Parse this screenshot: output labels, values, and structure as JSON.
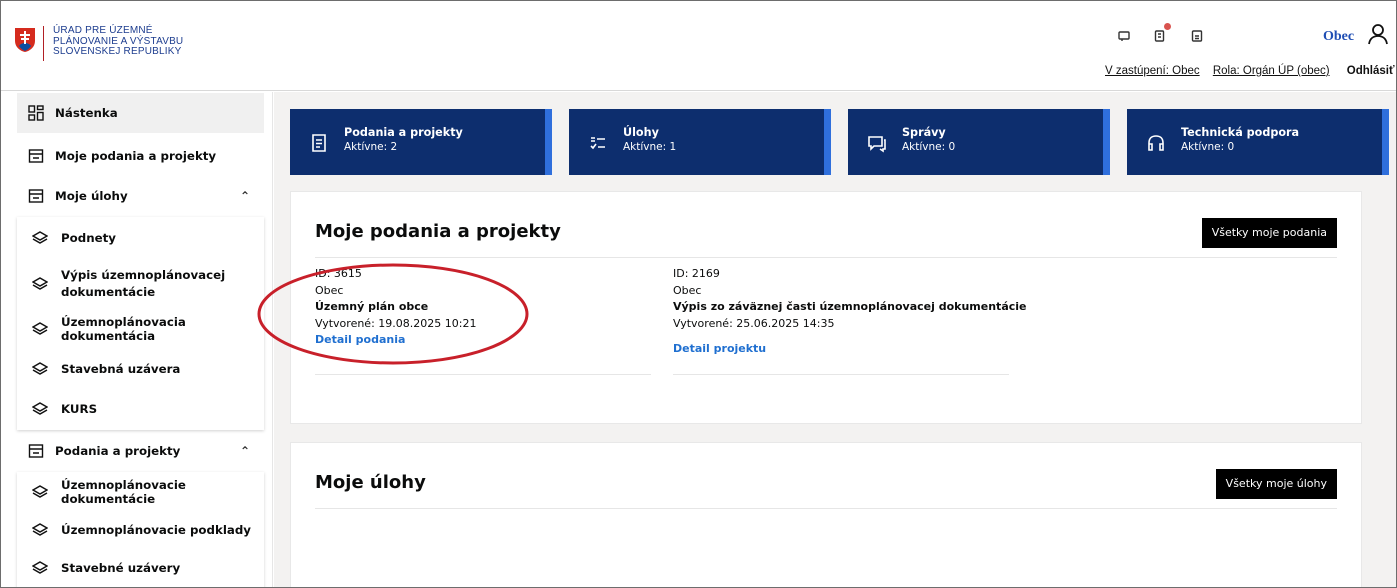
{
  "header": {
    "logo_lines": [
      "ÚRAD PRE ÚZEMNÉ",
      "PLÁNOVANIE A VÝSTAVBU",
      "SLOVENSKEJ REPUBLIKY"
    ],
    "user_name": "Obec",
    "links": {
      "zastupenie": "V zastúpení: Obec",
      "rola": "Rola: Orgán ÚP (obec)",
      "logout": "Odhlásiť sa"
    }
  },
  "sidebar": {
    "dashboard": "Nástenka",
    "my_submissions": "Moje podania a projekty",
    "my_tasks": "Moje úlohy",
    "my_tasks_items": [
      "Podnety",
      "Výpis územnoplánovacej dokumentácie",
      "Územnoplánovacia dokumentácia",
      "Stavebná uzávera",
      "KURS"
    ],
    "submissions": "Podania a projekty",
    "submissions_items": [
      "Územnoplánovacie dokumentácie",
      "Územnoplánovacie podklady",
      "Stavebné uzávery"
    ]
  },
  "tiles": [
    {
      "title": "Podania a projekty",
      "status": "Aktívne: 2",
      "icon": "document-list-icon"
    },
    {
      "title": "Úlohy",
      "status": "Aktívne: 1",
      "icon": "checklist-icon"
    },
    {
      "title": "Správy",
      "status": "Aktívne: 0",
      "icon": "message-icon"
    },
    {
      "title": "Technická podpora",
      "status": "Aktívne: 0",
      "icon": "headset-icon"
    }
  ],
  "submissions_card": {
    "title": "Moje podania a projekty",
    "button": "Všetky moje podania",
    "items": [
      {
        "id": "ID: 3615",
        "owner": "Obec",
        "name": "Územný plán obce",
        "created": "Vytvorené: 19.08.2025 10:21",
        "link": "Detail podania"
      },
      {
        "id": "ID: 2169",
        "owner": "Obec",
        "name": "Výpis zo záväznej časti územnoplánovacej dokumentácie",
        "created": "Vytvorené: 25.06.2025 14:35",
        "link": "Detail projektu"
      }
    ]
  },
  "tasks_card": {
    "title": "Moje úlohy",
    "button": "Všetky moje úlohy"
  },
  "colors": {
    "navy": "#0d2e6e",
    "accent_bar": "#2f6fdc",
    "link": "#1f6fd0",
    "annotation": "#c8202a"
  }
}
